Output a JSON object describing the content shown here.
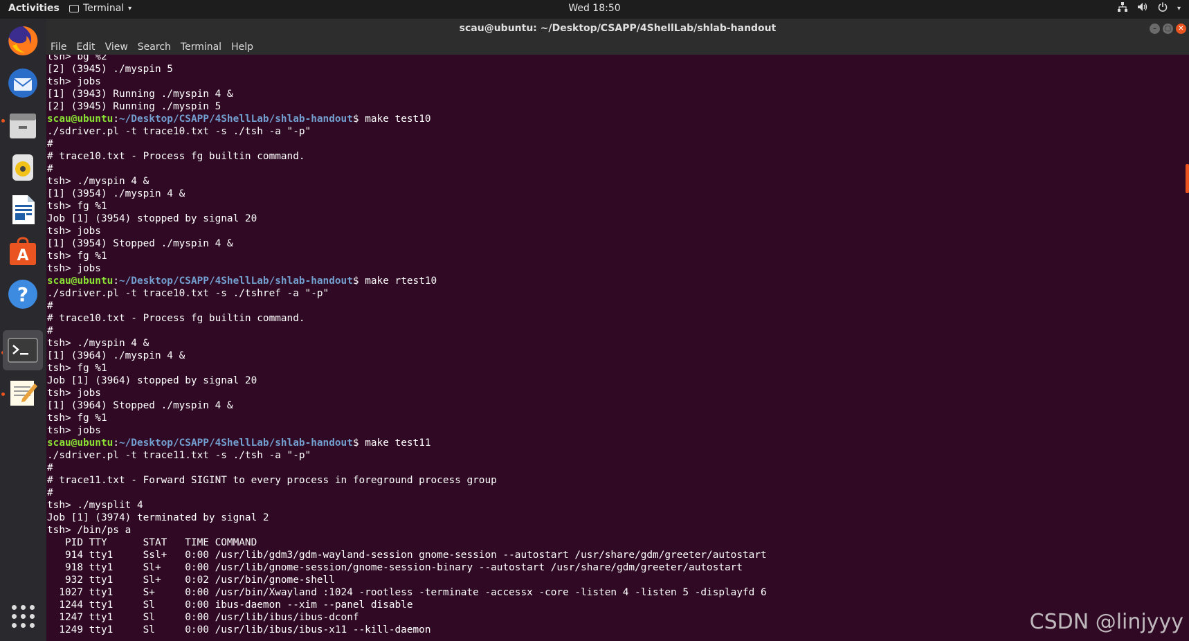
{
  "topbar": {
    "activities": "Activities",
    "app_name": "Terminal",
    "clock": "Wed 18:50"
  },
  "window": {
    "title": "scau@ubuntu: ~/Desktop/CSAPP/4ShellLab/shlab-handout"
  },
  "menu": [
    "File",
    "Edit",
    "View",
    "Search",
    "Terminal",
    "Help"
  ],
  "dock": [
    "Firefox",
    "Thunderbird",
    "Files",
    "Rhythmbox",
    "LibreOffice Writer",
    "Ubuntu Software",
    "Help",
    "Terminal",
    "Text Editor",
    "Show Applications"
  ],
  "prompt": {
    "user": "scau@ubuntu",
    "path": "~/Desktop/CSAPP/4ShellLab/shlab-handout"
  },
  "lines": [
    {
      "t": "tsh> bg %2"
    },
    {
      "t": "[2] (3945) ./myspin 5"
    },
    {
      "t": "tsh> jobs"
    },
    {
      "t": "[1] (3943) Running ./myspin 4 &"
    },
    {
      "t": "[2] (3945) Running ./myspin 5"
    },
    {
      "p": true,
      "t": "$ make test10"
    },
    {
      "t": "./sdriver.pl -t trace10.txt -s ./tsh -a \"-p\""
    },
    {
      "t": "#"
    },
    {
      "t": "# trace10.txt - Process fg builtin command."
    },
    {
      "t": "#"
    },
    {
      "t": "tsh> ./myspin 4 &"
    },
    {
      "t": "[1] (3954) ./myspin 4 &"
    },
    {
      "t": "tsh> fg %1"
    },
    {
      "t": "Job [1] (3954) stopped by signal 20"
    },
    {
      "t": "tsh> jobs"
    },
    {
      "t": "[1] (3954) Stopped ./myspin 4 &"
    },
    {
      "t": "tsh> fg %1"
    },
    {
      "t": "tsh> jobs"
    },
    {
      "p": true,
      "t": "$ make rtest10"
    },
    {
      "t": "./sdriver.pl -t trace10.txt -s ./tshref -a \"-p\""
    },
    {
      "t": "#"
    },
    {
      "t": "# trace10.txt - Process fg builtin command."
    },
    {
      "t": "#"
    },
    {
      "t": "tsh> ./myspin 4 &"
    },
    {
      "t": "[1] (3964) ./myspin 4 &"
    },
    {
      "t": "tsh> fg %1"
    },
    {
      "t": "Job [1] (3964) stopped by signal 20"
    },
    {
      "t": "tsh> jobs"
    },
    {
      "t": "[1] (3964) Stopped ./myspin 4 &"
    },
    {
      "t": "tsh> fg %1"
    },
    {
      "t": "tsh> jobs"
    },
    {
      "p": true,
      "t": "$ make test11"
    },
    {
      "t": "./sdriver.pl -t trace11.txt -s ./tsh -a \"-p\""
    },
    {
      "t": "#"
    },
    {
      "t": "# trace11.txt - Forward SIGINT to every process in foreground process group"
    },
    {
      "t": "#"
    },
    {
      "t": "tsh> ./mysplit 4"
    },
    {
      "t": "Job [1] (3974) terminated by signal 2"
    },
    {
      "t": "tsh> /bin/ps a"
    },
    {
      "t": "   PID TTY      STAT   TIME COMMAND"
    },
    {
      "t": "   914 tty1     Ssl+   0:00 /usr/lib/gdm3/gdm-wayland-session gnome-session --autostart /usr/share/gdm/greeter/autostart"
    },
    {
      "t": "   918 tty1     Sl+    0:00 /usr/lib/gnome-session/gnome-session-binary --autostart /usr/share/gdm/greeter/autostart"
    },
    {
      "t": "   932 tty1     Sl+    0:02 /usr/bin/gnome-shell"
    },
    {
      "t": "  1027 tty1     S+     0:00 /usr/bin/Xwayland :1024 -rootless -terminate -accessx -core -listen 4 -listen 5 -displayfd 6"
    },
    {
      "t": "  1244 tty1     Sl     0:00 ibus-daemon --xim --panel disable"
    },
    {
      "t": "  1247 tty1     Sl     0:00 /usr/lib/ibus/ibus-dconf"
    },
    {
      "t": "  1249 tty1     Sl     0:00 /usr/lib/ibus/ibus-x11 --kill-daemon"
    }
  ],
  "watermark": "CSDN @linjyyy"
}
